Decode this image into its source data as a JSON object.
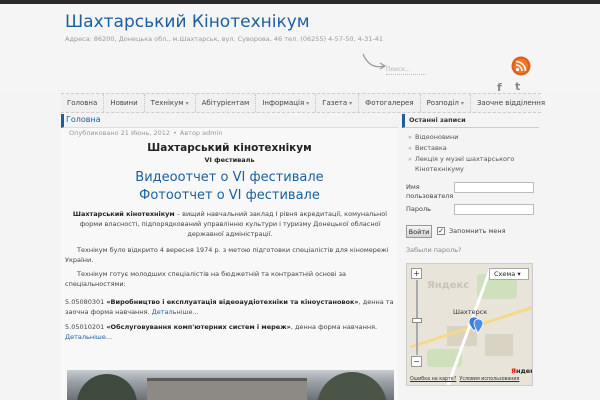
{
  "header": {
    "site_title": "Шахтарський Кінотехнікум",
    "site_description": "Адреса: 86200, Донецька обл., м.Шахтарськ, вул. Суворова, 46 тел. (06255) 4-57-50, 4-31-41",
    "search_placeholder": "Поиск...",
    "icons": [
      "rss-icon",
      "facebook-icon",
      "twitter-icon"
    ],
    "facebook_glyph": "f",
    "twitter_glyph": "t"
  },
  "nav": {
    "items": [
      {
        "label": "Головна",
        "has_submenu": false
      },
      {
        "label": "Новини",
        "has_submenu": false
      },
      {
        "label": "Технікум",
        "has_submenu": true
      },
      {
        "label": "Абітурієнтам",
        "has_submenu": false
      },
      {
        "label": "Інформація",
        "has_submenu": true
      },
      {
        "label": "Газета",
        "has_submenu": true
      },
      {
        "label": "Фотогалерея",
        "has_submenu": false
      },
      {
        "label": "Розподіл",
        "has_submenu": true
      },
      {
        "label": "Заочне відділення",
        "has_submenu": false
      }
    ]
  },
  "main": {
    "breadcrumb": "Головна",
    "meta": {
      "published": "Опубликовано 21 Июнь, 2012",
      "author": "Автор admin"
    },
    "title": "Шахтарський кінотехнікум",
    "subtitle": "VI фестиваль",
    "video_link": "Видеоотчет о VI фестивале",
    "photo_link": "Фотоотчет о VI фестивале",
    "intro_bold": "Шахтарський кінотехнікум",
    "intro_rest": " – вищий навчальний заклад І рівня акредитації, комунальної форми власності, підпорядкований управлінню культури і туризму Донецької обласної державної адміністрації.",
    "history": "Технікум було відкрито 4 вересня 1974 р. з метою підготовки спеціалістів для кіномережі України.",
    "preparation": "Технікум готує молодших спеціалістів на бюджетній та контрактній основі за спеціальностями:",
    "spec1_code": "5.05080301 ",
    "spec1_name": "«Виробництво і експлуатація відеоаудіотехніки та кіноустановок»",
    "spec1_rest": ", денна та заочна форма навчання. ",
    "spec2_code": "5.05010201 ",
    "spec2_name": "«Обслуговування комп'ютерних систем і мереж»",
    "spec2_rest": ", денна форма навчання. ",
    "more_link": "Детальніше..."
  },
  "sidebar": {
    "recent_title": "Останні записи",
    "recent_items": [
      "Відеоновини",
      "Виставка",
      "Лекція у музеї шахтарського Кінотехнікуму"
    ],
    "login": {
      "username_label": "Имя пользователя",
      "password_label": "Пароль",
      "submit_label": "Войти",
      "remember_label": "Запомнить меня",
      "remember_checked": true,
      "remember_mark": "✓",
      "forgot_link": "Забыли пароль?"
    },
    "map": {
      "scheme_label": "Схема ▾",
      "city_label": "Шахтерск",
      "watermark": "Яндекс",
      "zoom_in": "+",
      "zoom_out": "−",
      "footer_link_1": "Ошибка на карте?",
      "footer_link_2": "Условия использования",
      "logo_ya": "Я",
      "logo_rest": "ндекс"
    }
  }
}
